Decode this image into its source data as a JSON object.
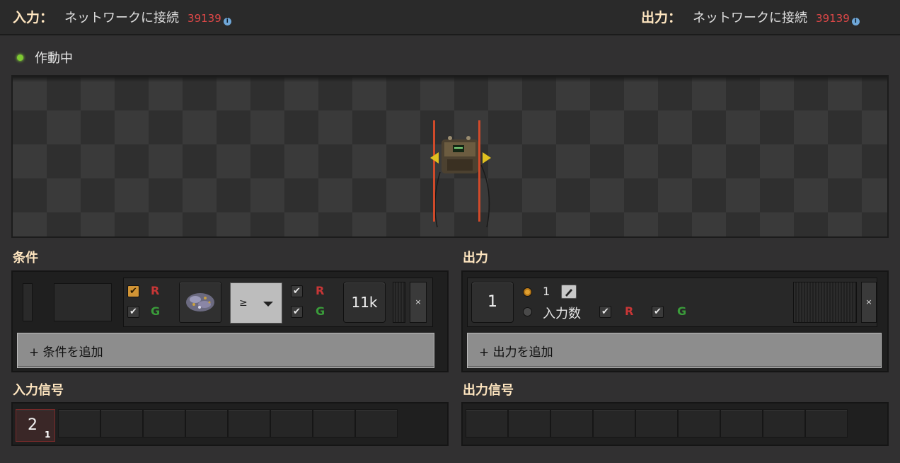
{
  "header": {
    "input_label": "入力",
    "output_label": "出力",
    "colon": "：",
    "input_network": "ネットワークに接続",
    "input_network_id": "39139",
    "output_network": "ネットワークに接続",
    "output_network_id": "39139",
    "info_glyph": "i"
  },
  "status": {
    "text": "作動中",
    "color": "#7ec932"
  },
  "conditions": {
    "title": "条件",
    "check_glyph": "✔",
    "wire_red_glyph": "R",
    "wire_green_glyph": "G",
    "comparator": "≥",
    "constant": "11k",
    "close_glyph": "×",
    "add_label": "+ 条件を追加"
  },
  "outputs": {
    "title": "出力",
    "signal_value": "1",
    "radio_constant_label": "1",
    "radio_input_count_label": "入力数",
    "check_glyph": "✔",
    "wire_red_glyph": "R",
    "wire_green_glyph": "G",
    "close_glyph": "×",
    "add_label": "+ 出力を追加"
  },
  "input_signals": {
    "title": "入力信号",
    "first_value": "2",
    "first_sub": "1"
  },
  "output_signals": {
    "title": "出力信号"
  },
  "icons": {
    "status": "status-dot-icon",
    "combinator": "decider-combinator-icon",
    "condition_signal": "electronic-circuit-icon",
    "edit": "pencil-icon",
    "dropdown": "chevron-down-icon"
  },
  "colors": {
    "accent_title": "#ffe6c0",
    "network_id": "#e04848",
    "wire_red": "#c83636",
    "wire_green": "#3a9c3a"
  }
}
